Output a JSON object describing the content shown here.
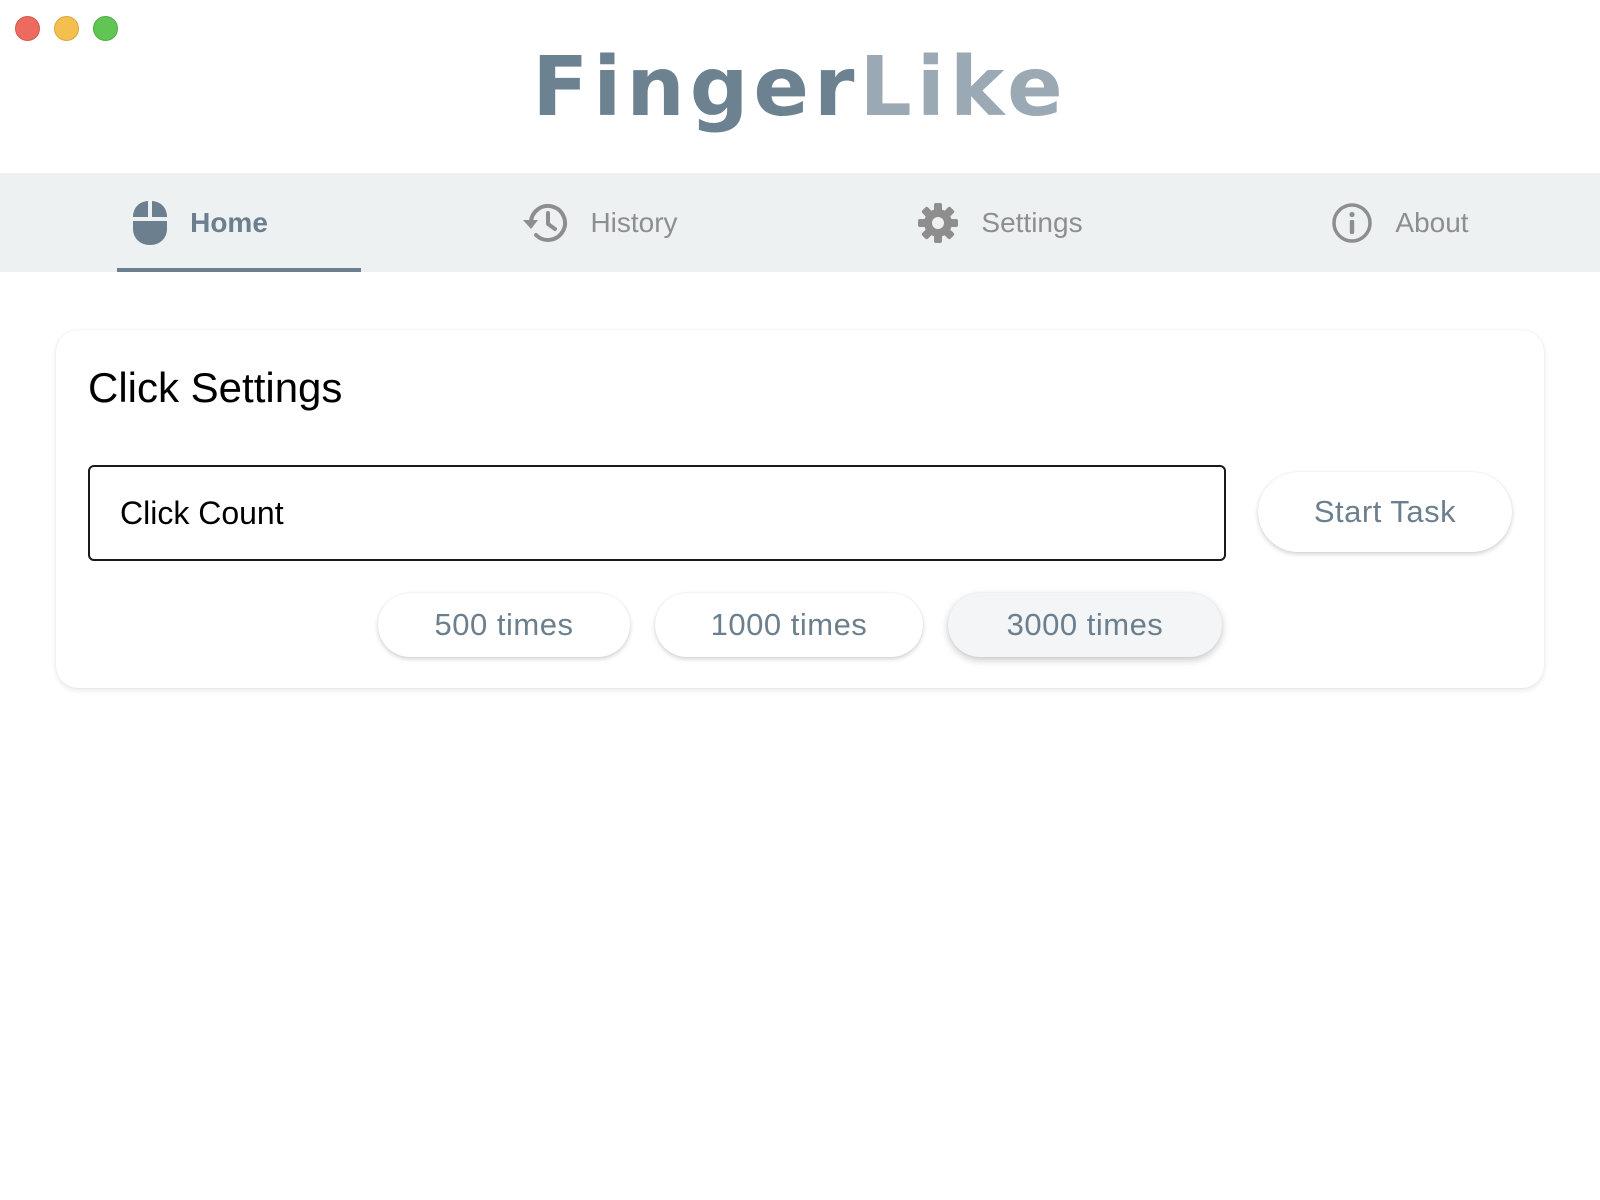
{
  "window": {
    "controls": [
      "close",
      "minimize",
      "zoom"
    ]
  },
  "logo": {
    "part1": "Finger",
    "part2": "Like"
  },
  "nav": {
    "tabs": [
      {
        "label": "Home",
        "icon": "mouse-icon",
        "active": true
      },
      {
        "label": "History",
        "icon": "history-icon",
        "active": false
      },
      {
        "label": "Settings",
        "icon": "gear-icon",
        "active": false
      },
      {
        "label": "About",
        "icon": "info-icon",
        "active": false
      }
    ]
  },
  "click_settings": {
    "title": "Click Settings",
    "count_placeholder": "Click Count",
    "count_value": "",
    "start_label": "Start Task",
    "presets": [
      "500 times",
      "1000 times",
      "3000 times"
    ]
  },
  "colors": {
    "accent": "#6b7f8e",
    "logo_light": "#9aa9b4",
    "nav_background": "#eef1f2",
    "inactive_tab": "#8e8e8e"
  }
}
